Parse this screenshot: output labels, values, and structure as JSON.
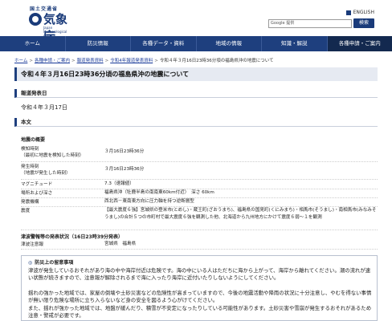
{
  "header": {
    "agency_small": "国土交通省",
    "agency_name": "気象庁",
    "agency_en": "Japan Meteorological Agency",
    "lang_label": "ENGLISH",
    "search_placeholder": "Google 提供",
    "search_button": "検索"
  },
  "nav": [
    {
      "label": "ホーム",
      "active": false
    },
    {
      "label": "防災情報",
      "active": false
    },
    {
      "label": "各種データ・資料",
      "active": false
    },
    {
      "label": "地域の情報",
      "active": false
    },
    {
      "label": "知識・解説",
      "active": false
    },
    {
      "label": "各種申請・ご案内",
      "active": true
    }
  ],
  "breadcrumb": [
    "ホーム",
    "各種申請・ご案内",
    "報道発表資料",
    "令和4年報道発表資料",
    "令和４年３月16日23時36分頃の福島県沖の地震について"
  ],
  "title": "令和４年３月16日23時36分頃の福島県沖の地震について",
  "sections": {
    "release_date_heading": "報道発表日",
    "release_date": "令和４年３月17日",
    "body_heading": "本文"
  },
  "overview": {
    "heading": "地震の概要",
    "rows": [
      {
        "k1": "検知時刻",
        "k2": "（最初に地震を検知した時刻）",
        "v": "３月16日23時36分"
      },
      {
        "k1": "発生時刻",
        "k2": "（地震が発生した時刻）",
        "v": "３月16日23時36分"
      },
      {
        "k1": "マグニチュード",
        "k2": "",
        "v": "7.3（速報値）"
      },
      {
        "k1": "場所および深さ",
        "k2": "",
        "v": "福島県沖（牡鹿半島の南南東60km付近）　深さ 60km"
      },
      {
        "k1": "発震機構",
        "k2": "",
        "v": "西北西－東南東方向に圧力軸を持つ逆断層型"
      },
      {
        "k1": "震度",
        "k2": "",
        "v": "【最大震度６強】宮城県の登米市(とめし)・蔵王町(ざおうまち)、福島県の国見町(くにみまち)・相馬市(そうまし)・南相馬市(みなみそうまし)の合計５つの市町村で最大震度６強を観測した他、北海道から九州地方にかけて震度６弱～１を観測"
      }
    ]
  },
  "tsunami": {
    "heading": "津波警報等の発表状況（16日23時39分発表）",
    "key": "津波注意報",
    "value": "宮城県　福島県"
  },
  "caution": {
    "heading": "防災上の留意事項",
    "paragraphs": [
      "津波が発生しているおそれがあり海の中や海岸付近は危険です。海の中にいる人はただちに海から上がって、海岸から離れてください。潮の流れが速い状態が続きますので、注意報が解除されるまで海に入ったり海岸に近付いたりしないようにしてください。",
      "揺れの強かった地域では、家屋の倒壊や土砂災害などの危険性が高まっていますので、今後の地震活動や降雨の状況に十分注意し、やむを得ない事情が無い限り危険な場所に立ち入らないなど身の安全を図るよう心がけてください。",
      "また、揺れが強かった地域では、地盤が緩んだり、積雪が不安定になったりしている可能性があります。土砂災害や雪崩が発生するおそれがあるため注意・警戒が必要です。"
    ]
  },
  "colors": {
    "nav_bg": "#1e3f7e",
    "nav_active": "#13294f",
    "title_bg": "#e6eaf2"
  }
}
